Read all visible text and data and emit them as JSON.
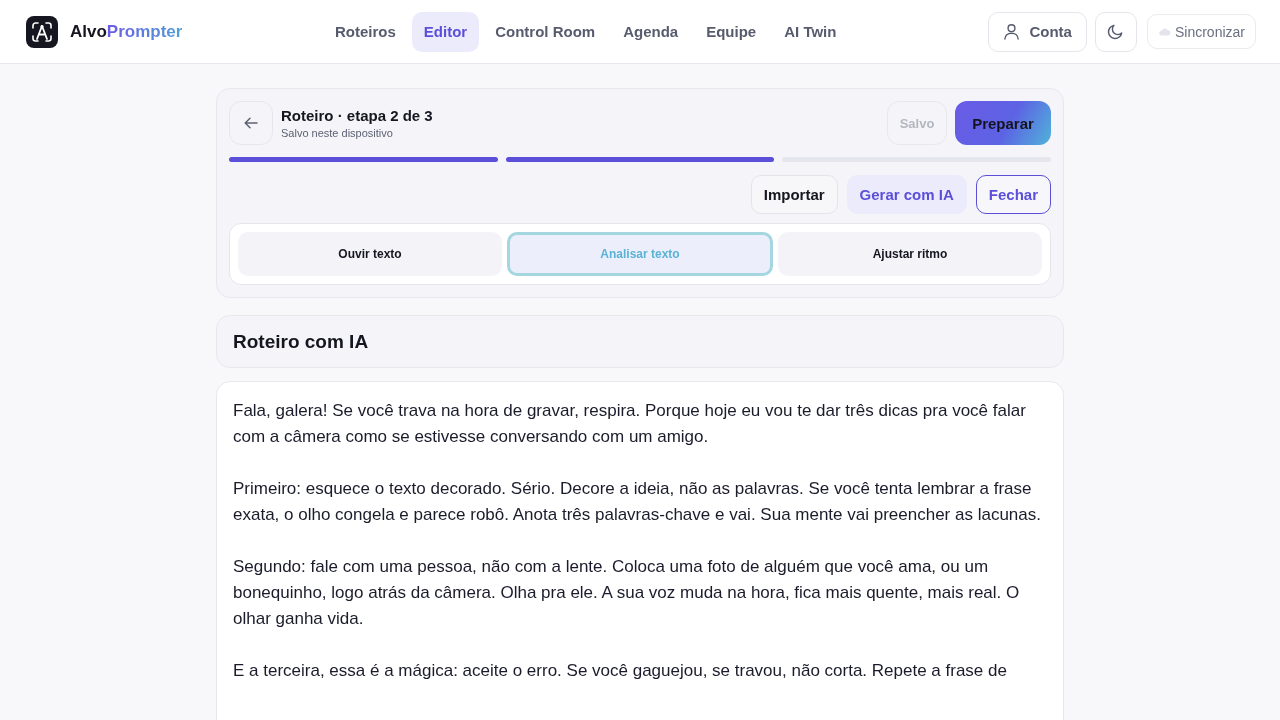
{
  "header": {
    "brand": {
      "primary": "Alvo",
      "accent": "Prompter"
    },
    "nav": [
      {
        "label": "Roteiros",
        "selected": false
      },
      {
        "label": "Editor",
        "selected": true
      },
      {
        "label": "Control Room",
        "selected": false
      },
      {
        "label": "Agenda",
        "selected": false
      },
      {
        "label": "Equipe",
        "selected": false
      },
      {
        "label": "AI Twin",
        "selected": false
      }
    ],
    "account_button": {
      "label": "Conta"
    },
    "sync_button": {
      "label": "Sincronizar",
      "disabled": true
    }
  },
  "editor": {
    "title": "Roteiro · etapa 2 de 3",
    "subtitle": "Salvo neste dispositivo",
    "save_button": {
      "label": "Salvo",
      "disabled": true
    },
    "primary_button": {
      "label": "Preparar"
    },
    "steps": [
      {
        "completed": true
      },
      {
        "completed": true
      },
      {
        "completed": false
      }
    ],
    "actions": [
      {
        "label": "Importar",
        "kind": "plain"
      },
      {
        "label": "Gerar com IA",
        "kind": "soft"
      },
      {
        "label": "Fechar",
        "kind": "outline"
      }
    ],
    "tools": [
      {
        "label": "Ouvir texto",
        "selected": false
      },
      {
        "label": "Analisar texto",
        "selected": true
      },
      {
        "label": "Ajustar ritmo",
        "selected": false
      }
    ]
  },
  "script_section": {
    "title": "Roteiro com IA"
  },
  "script": {
    "paragraphs": [
      "Fala, galera! Se você trava na hora de gravar, respira. Porque hoje eu vou te dar três dicas pra você falar com a câmera como se estivesse conversando com um amigo.",
      "Primeiro: esquece o texto decorado. Sério. Decore a ideia, não as palavras. Se você tenta lembrar a frase exata, o olho congela e parece robô. Anota três palavras-chave e vai. Sua mente vai preencher as lacunas.",
      "Segundo: fale com uma pessoa, não com a lente. Coloca uma foto de alguém que você ama, ou um bonequinho, logo atrás da câmera. Olha pra ele. A sua voz muda na hora, fica mais quente, mais real. O olhar ganha vida.",
      "E a terceira, essa é a mágica: aceite o erro. Se você gaguejou, se travou, não corta. Repete a frase de"
    ]
  }
}
